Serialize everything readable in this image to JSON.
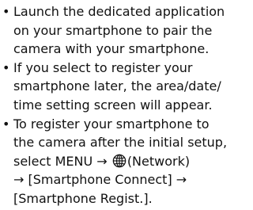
{
  "bullet_char": "•",
  "items": [
    {
      "lines": [
        "Launch the dedicated application",
        "on your smartphone to pair the",
        "camera with your smartphone."
      ]
    },
    {
      "lines": [
        "If you select to register your",
        "smartphone later, the area/date/",
        "time setting screen will appear."
      ]
    },
    {
      "lines": [
        "To register your smartphone to",
        "the camera after the initial setup,"
      ],
      "menu_path": {
        "lead": "select MENU →",
        "icon": "globe-icon",
        "after_icon": "(Network)",
        "line2": "→ [Smartphone Connect] →",
        "line3": "[Smartphone Regist.]."
      }
    }
  ]
}
